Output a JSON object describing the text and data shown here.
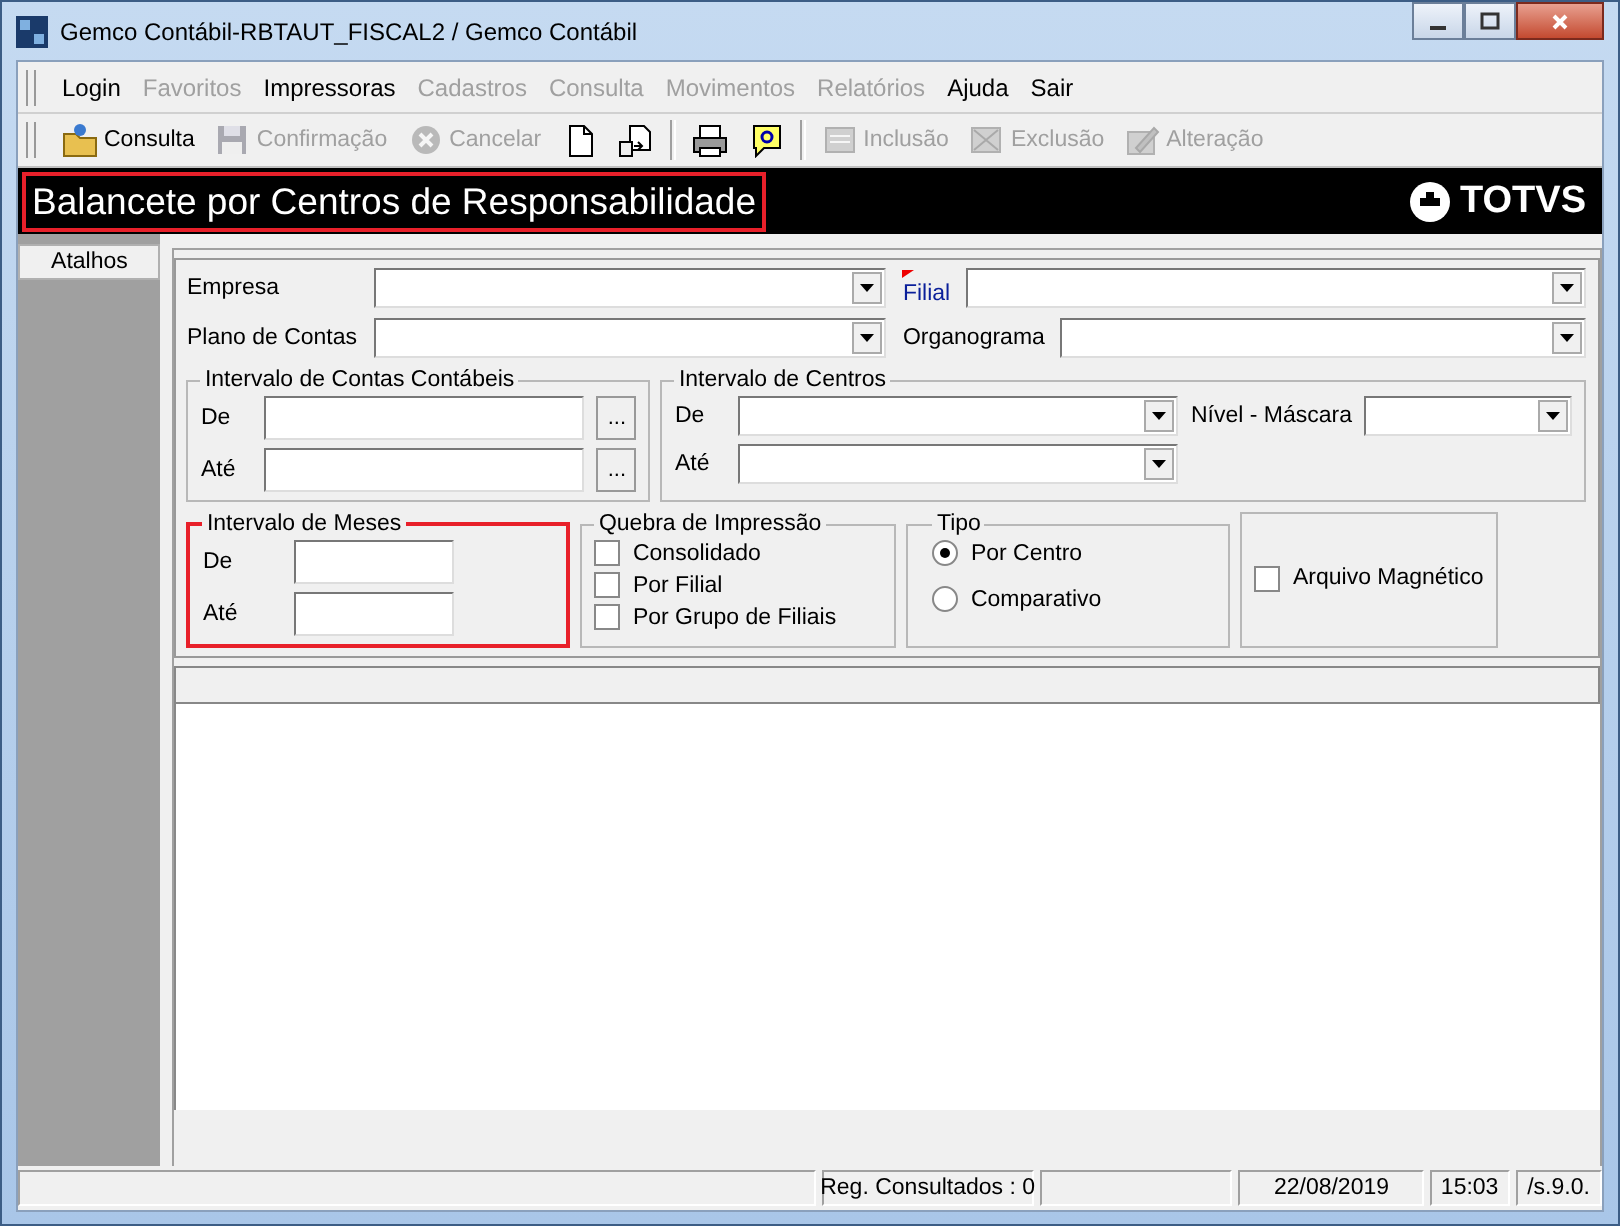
{
  "window": {
    "title": "Gemco Contábil-RBTAUT_FISCAL2 / Gemco Contábil"
  },
  "menu": [
    {
      "label": "Login",
      "disabled": false
    },
    {
      "label": "Favoritos",
      "disabled": true
    },
    {
      "label": "Impressoras",
      "disabled": false
    },
    {
      "label": "Cadastros",
      "disabled": true
    },
    {
      "label": "Consulta",
      "disabled": true
    },
    {
      "label": "Movimentos",
      "disabled": true
    },
    {
      "label": "Relatórios",
      "disabled": true
    },
    {
      "label": "Ajuda",
      "disabled": false
    },
    {
      "label": "Sair",
      "disabled": false
    }
  ],
  "toolbar": [
    {
      "kind": "button",
      "label": "Consulta",
      "disabled": false
    },
    {
      "kind": "button",
      "label": "Confirmação",
      "disabled": true
    },
    {
      "kind": "button",
      "label": "Cancelar",
      "disabled": true
    },
    {
      "kind": "button",
      "disabled": false
    },
    {
      "kind": "button",
      "disabled": false
    },
    {
      "kind": "separator"
    },
    {
      "kind": "button",
      "disabled": false
    },
    {
      "kind": "button",
      "disabled": false
    },
    {
      "kind": "separator"
    },
    {
      "kind": "button",
      "label": "Inclusão",
      "disabled": true
    },
    {
      "kind": "button",
      "label": "Exclusão",
      "disabled": true
    },
    {
      "kind": "button",
      "label": "Alteração",
      "disabled": true
    }
  ],
  "header": {
    "title": "Balancete por Centros de Responsabilidade",
    "highlighted": true,
    "logo": "TOTVS"
  },
  "sidebar": {
    "tab": "Atalhos"
  },
  "form": {
    "rows": [
      [
        {
          "label": "Empresa",
          "required": false
        },
        {
          "label": "Filial",
          "required": true
        }
      ],
      [
        {
          "label": "Plano de Contas",
          "required": false
        },
        {
          "label": "Organograma",
          "required": false
        }
      ]
    ],
    "contas": {
      "title": "Intervalo de Contas Contábeis",
      "fields": [
        {
          "label": "De",
          "button": "..."
        },
        {
          "label": "Até",
          "button": "..."
        }
      ]
    },
    "centros": {
      "title": "Intervalo de Centros",
      "fields": [
        {
          "label": "De"
        },
        {
          "label": "Nível - Máscara"
        },
        {
          "label": "Até"
        }
      ]
    },
    "meses": {
      "title": "Intervalo de Meses",
      "highlighted": true,
      "fields": [
        {
          "label": "De"
        },
        {
          "label": "Até"
        }
      ]
    },
    "quebra": {
      "title": "Quebra de Impressão",
      "options": [
        {
          "label": "Consolidado",
          "checked": false
        },
        {
          "label": "Por Filial",
          "checked": false
        },
        {
          "label": "Por Grupo de Filiais",
          "checked": false
        }
      ]
    },
    "tipo": {
      "title": "Tipo",
      "options": [
        {
          "label": "Por Centro",
          "selected": true
        },
        {
          "label": "Comparativo",
          "selected": false
        }
      ]
    },
    "arquivo": {
      "label": "Arquivo Magnético",
      "checked": false
    }
  },
  "status_bar": [
    {
      "kind": "blank"
    },
    {
      "kind": "text",
      "text": "Reg. Consultados : 0"
    },
    {
      "kind": "blank"
    },
    {
      "kind": "text",
      "text": "22/08/2019"
    },
    {
      "kind": "text",
      "text": "15:03"
    },
    {
      "kind": "text",
      "text": "/s.9.0."
    }
  ]
}
